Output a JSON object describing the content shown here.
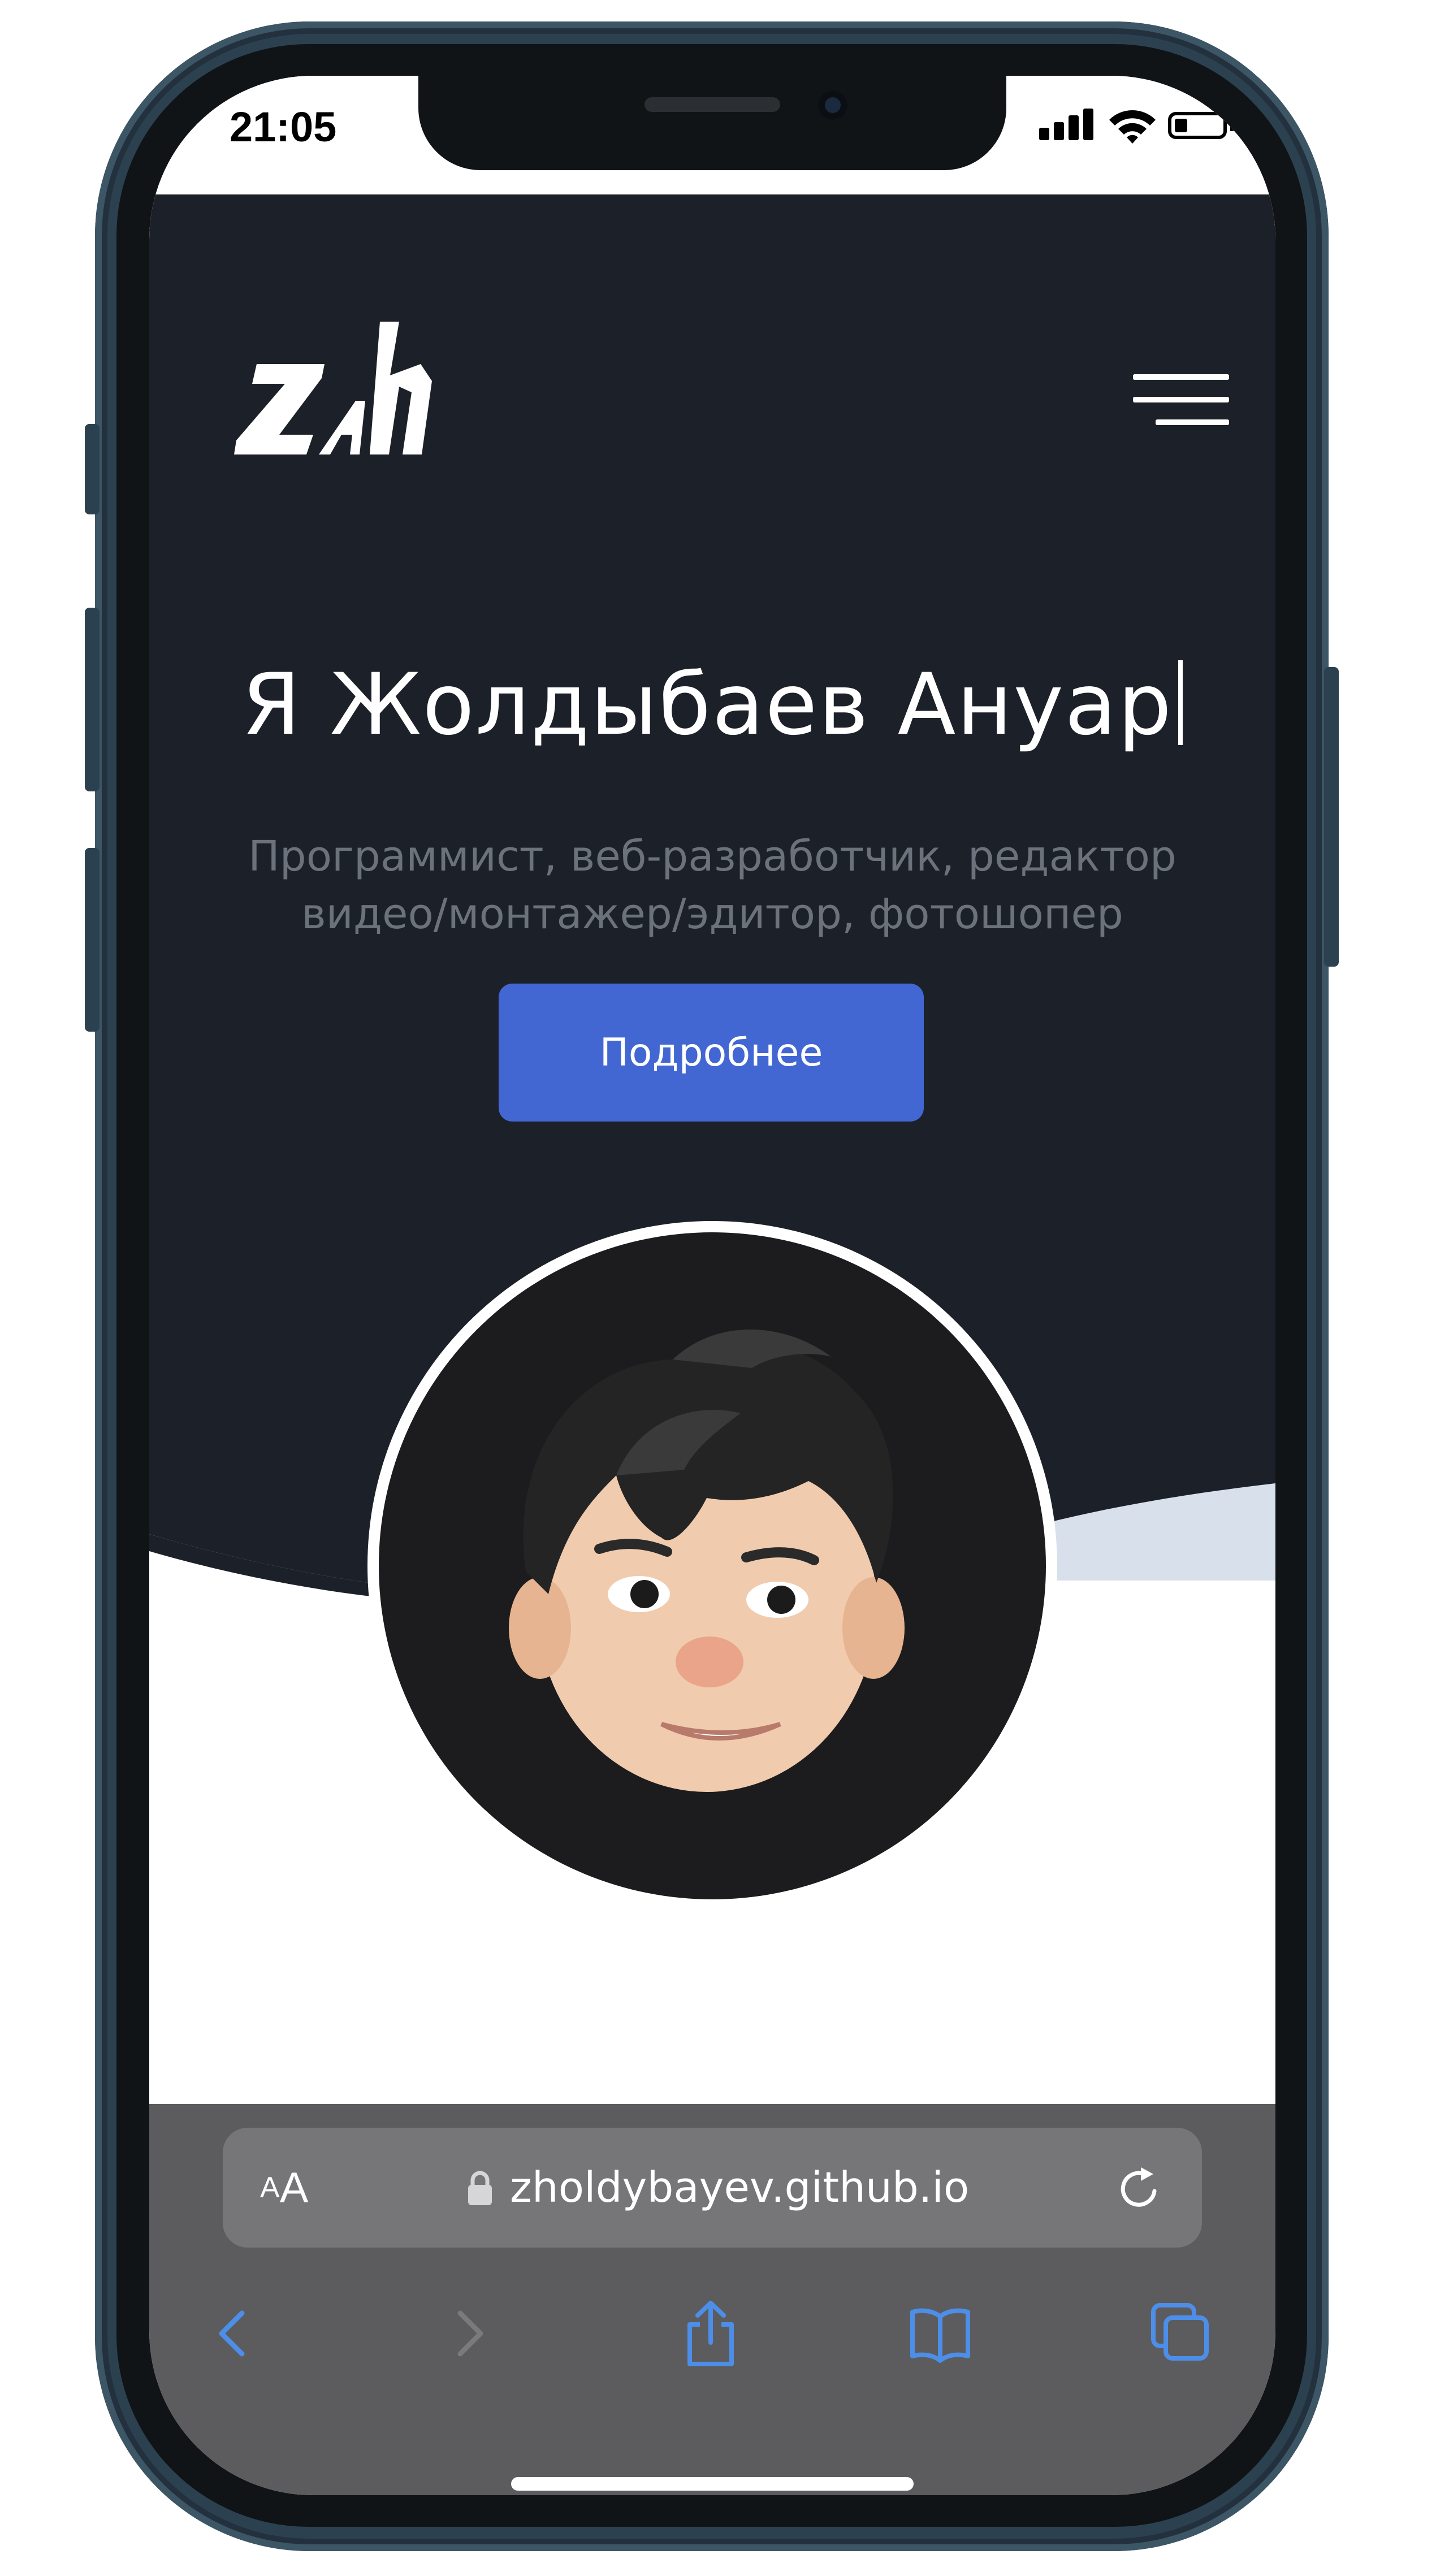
{
  "status_bar": {
    "time": "21:05"
  },
  "header": {
    "logo_text": "zh",
    "menu_icon": "hamburger-menu-icon"
  },
  "hero": {
    "title": "Я Жолдыбаев Ануар",
    "subtitle_line1": "Программист, веб-разработчик, редактор",
    "subtitle_line2": "видео/монтажер/эдитор, фотошопер",
    "cta_label": "Подробнее",
    "avatar": "memoji-avatar"
  },
  "browser": {
    "text_size_small": "A",
    "text_size_large": "A",
    "url": "zholdybayev.github.io",
    "icons": [
      "lock-icon",
      "reload-icon",
      "back-icon",
      "forward-icon",
      "share-icon",
      "bookmarks-icon",
      "tabs-icon"
    ]
  },
  "colors": {
    "hero_background": "#1c2129",
    "accent": "#4267d3",
    "wave_light": "#d8e0ec",
    "browser_bar": "#5c5c5e",
    "toolbar_icon": "#4d8ee8"
  }
}
